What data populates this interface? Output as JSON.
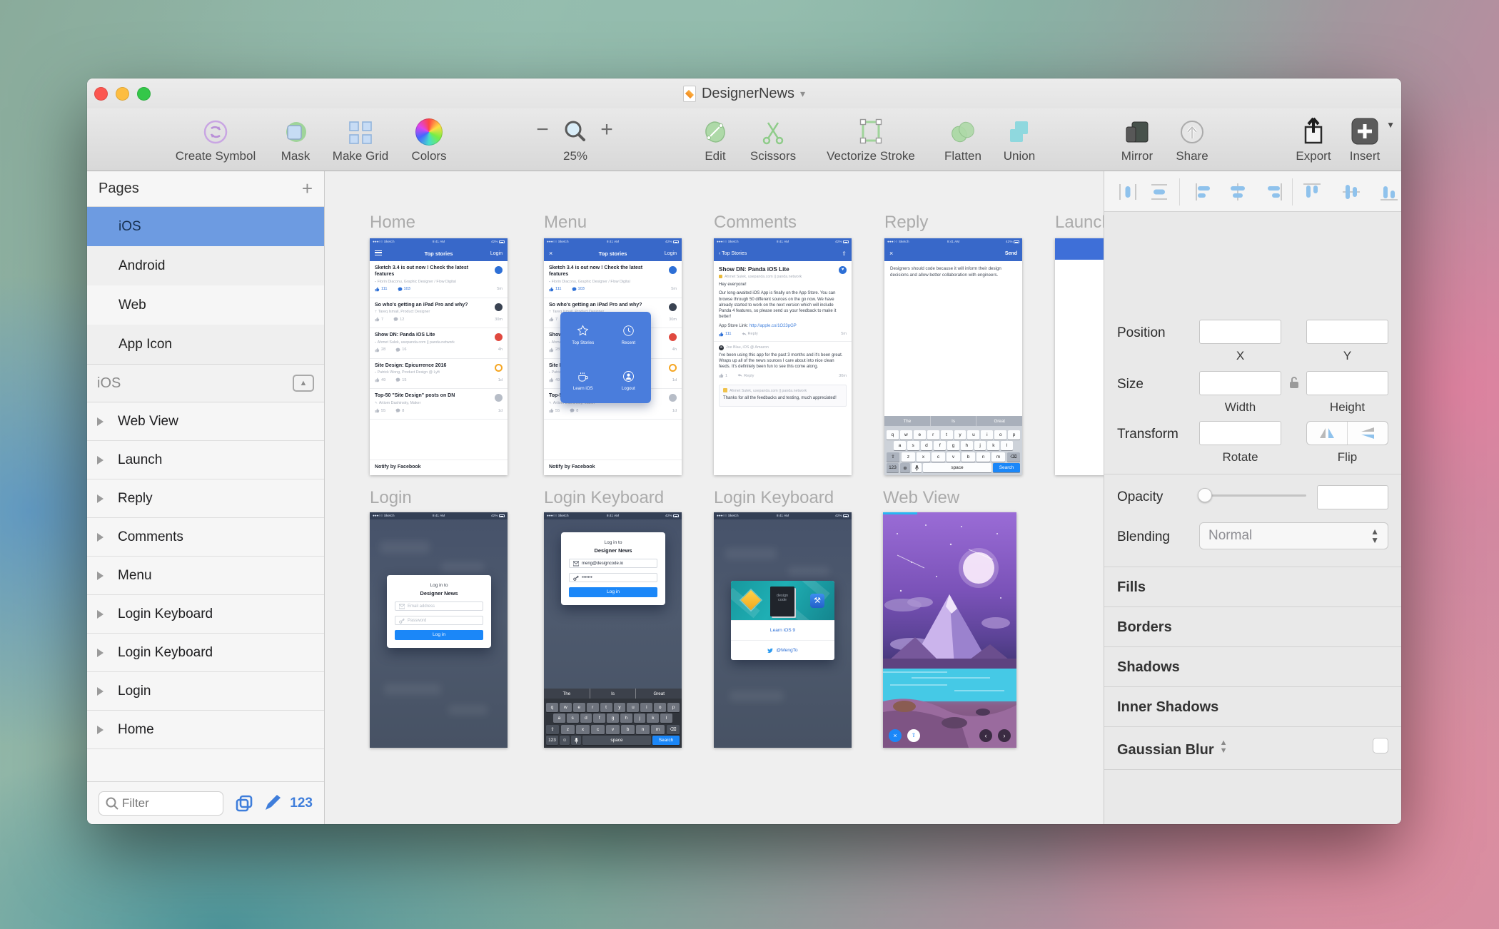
{
  "window": {
    "title": "DesignerNews"
  },
  "toolbar": {
    "create_symbol": "Create Symbol",
    "mask": "Mask",
    "make_grid": "Make Grid",
    "colors": "Colors",
    "zoom_level": "25%",
    "zoom_out": "−",
    "zoom_in": "+",
    "edit": "Edit",
    "scissors": "Scissors",
    "vectorize_stroke": "Vectorize Stroke",
    "flatten": "Flatten",
    "union": "Union",
    "mirror": "Mirror",
    "share": "Share",
    "export": "Export",
    "insert": "Insert"
  },
  "sidebar": {
    "pages_header": "Pages",
    "add_page": "+",
    "pages": [
      {
        "label": "iOS"
      },
      {
        "label": "Android"
      },
      {
        "label": "Web"
      },
      {
        "label": "App Icon"
      }
    ],
    "selected_page": "iOS",
    "section_header": "iOS",
    "layers": [
      {
        "label": "Web View"
      },
      {
        "label": "Launch"
      },
      {
        "label": "Reply"
      },
      {
        "label": "Comments"
      },
      {
        "label": "Menu"
      },
      {
        "label": "Login Keyboard"
      },
      {
        "label": "Login Keyboard"
      },
      {
        "label": "Login"
      },
      {
        "label": "Home"
      }
    ],
    "filter_placeholder": "Filter",
    "count": "123"
  },
  "inspector": {
    "position": "Position",
    "x": "X",
    "y": "Y",
    "size": "Size",
    "width": "Width",
    "height": "Height",
    "transform": "Transform",
    "rotate": "Rotate",
    "flip": "Flip",
    "opacity": "Opacity",
    "blending": "Blending",
    "blending_value": "Normal",
    "fills": "Fills",
    "borders": "Borders",
    "shadows": "Shadows",
    "inner_shadows": "Inner Shadows",
    "gaussian_blur": "Gaussian Blur"
  },
  "phone": {
    "carrier": "●●●○○ Sketch",
    "time": "9:41 AM",
    "battery": "42%"
  },
  "stories": [
    {
      "title": "Sketch 3.4 is out now ! Check the latest features",
      "mark": "▪",
      "meta": "Florin Diaconu, Graphic Designer / Flow Digital",
      "votes": "111",
      "comments": "103",
      "time": "5m",
      "badge": "blue",
      "voted": true
    },
    {
      "title": "So who's getting an iPad Pro and why?",
      "mark": "T",
      "meta": "Tareq Ismail, Product Designer",
      "votes": "7",
      "comments": "12",
      "time": "30m",
      "badge": "dark",
      "voted": false
    },
    {
      "title": "Show DN: Panda iOS Lite",
      "mark": "▪",
      "meta": "Ahmet Sulek, usepanda.com || panda.network",
      "votes": "28",
      "comments": "16",
      "time": "4h",
      "badge": "red",
      "voted": false
    },
    {
      "title": "Site Design: Epicurrence 2016",
      "mark": "▪",
      "meta": "Patrick Wong, Product Design @ Lyft",
      "votes": "49",
      "comments": "15",
      "time": "1d",
      "badge": "orange",
      "voted": false
    },
    {
      "title": "Top-50 \"Site Design\" posts on DN",
      "mark": "✎",
      "meta": "Artiom Dashinsky, Maker",
      "votes": "55",
      "comments": "8",
      "time": "1d",
      "badge": "gray",
      "voted": false
    }
  ],
  "keyboard": {
    "suggestions": [
      "The",
      "Is",
      "Great"
    ],
    "row1": [
      "q",
      "w",
      "e",
      "r",
      "t",
      "y",
      "u",
      "i",
      "o",
      "p"
    ],
    "row2": [
      "a",
      "s",
      "d",
      "f",
      "g",
      "h",
      "j",
      "k",
      "l"
    ],
    "row3": [
      "z",
      "x",
      "c",
      "v",
      "b",
      "n",
      "m"
    ],
    "shift": "⇧",
    "backspace": "⌫",
    "num": "123",
    "emoji": "☺",
    "globe": "⊕",
    "space": "space",
    "search": "Search"
  },
  "artboards": {
    "home": {
      "label": "Home",
      "nav_title": "Top stories",
      "nav_right": "Login",
      "footer": "Notify by Facebook"
    },
    "menu": {
      "label": "Menu",
      "nav_title": "Top stories",
      "nav_right": "Login",
      "footer": "Notify by Facebook",
      "overlay": {
        "item1": "Top Stories",
        "item2": "Recent",
        "item3": "Learn iOS",
        "item4": "Logout"
      }
    },
    "comments": {
      "label": "Comments",
      "nav_back": "Top Stories",
      "title": "Show DN: Panda iOS Lite",
      "author": "Ahmet Sulek, usepanda.com || panda.network",
      "greeting": "Hey everyone!",
      "body": "Our long-awaited iOS App is finally on the App Store. You can browse through 50 different sources on the go now. We have already started to work on the next version which will include Panda 4 features, so please send us your feedback to make it better!",
      "link_label": "App Store Link:",
      "link_url": "http://apple.co/1O23pGP",
      "votes": "111",
      "reply": "Reply",
      "time": "5m",
      "comment_author": "Joe Blau, iOS @ Amazon",
      "comment_body": "I've been using this app for the past 3 months and it's been great. Wraps up all of the news sources I care about into nice clean feeds. It's definitely been fun to see this come along.",
      "comment_votes": "1",
      "comment_time": "30m",
      "reply_author": "Ahmet Sulek, usepanda.com || panda.network",
      "reply_body": "Thanks for all the feedbacks and testing, much appreciated!"
    },
    "reply": {
      "label": "Reply",
      "nav_left": "×",
      "nav_right": "Send",
      "draft": "Designers should code because it will inform their design decisions and allow better collaboration with engineers."
    },
    "launch": {
      "label": "Launch"
    },
    "login": {
      "label": "Login",
      "card_line1": "Log in to",
      "card_line2": "Designer News",
      "email_placeholder": "Email address",
      "password_placeholder": "Password",
      "button": "Log in"
    },
    "login_keyboard_1": {
      "label": "Login Keyboard",
      "card_line1": "Log in to",
      "card_line2": "Designer News",
      "email": "meng@designcode.io",
      "password": "•••••••",
      "button": "Log in"
    },
    "login_keyboard_2": {
      "label": "Login Keyboard",
      "link1": "Learn iOS 9",
      "link2": "@MengTo"
    },
    "web_view": {
      "label": "Web View"
    }
  },
  "icons": {
    "create-symbol": "circular-arrows",
    "mask": "circle-square-overlap",
    "make-grid": "four-squares",
    "colors": "color-wheel",
    "zoom": "magnifier",
    "edit": "pen-ellipse",
    "scissors": "scissors",
    "vectorize-stroke": "rect-handles",
    "flatten": "overlapping-ellipses",
    "union": "overlapping-squares",
    "mirror": "devices",
    "share": "globe-up-arrow",
    "export": "arrow-out-of-box",
    "insert": "plus-square"
  },
  "colors": {
    "dn_nav_blue": "#3868C9",
    "menu_overlay_blue": "#4A7DDC",
    "action_blue": "#1B87F8",
    "selection_blue": "#6D9BE1",
    "link_blue": "#3E7EDC",
    "sidebar_accent_blue": "#3F7EDB",
    "badge_red": "#E0493F",
    "badge_orange": "#F5A623",
    "webview_loading_cyan": "#29B6F2"
  }
}
